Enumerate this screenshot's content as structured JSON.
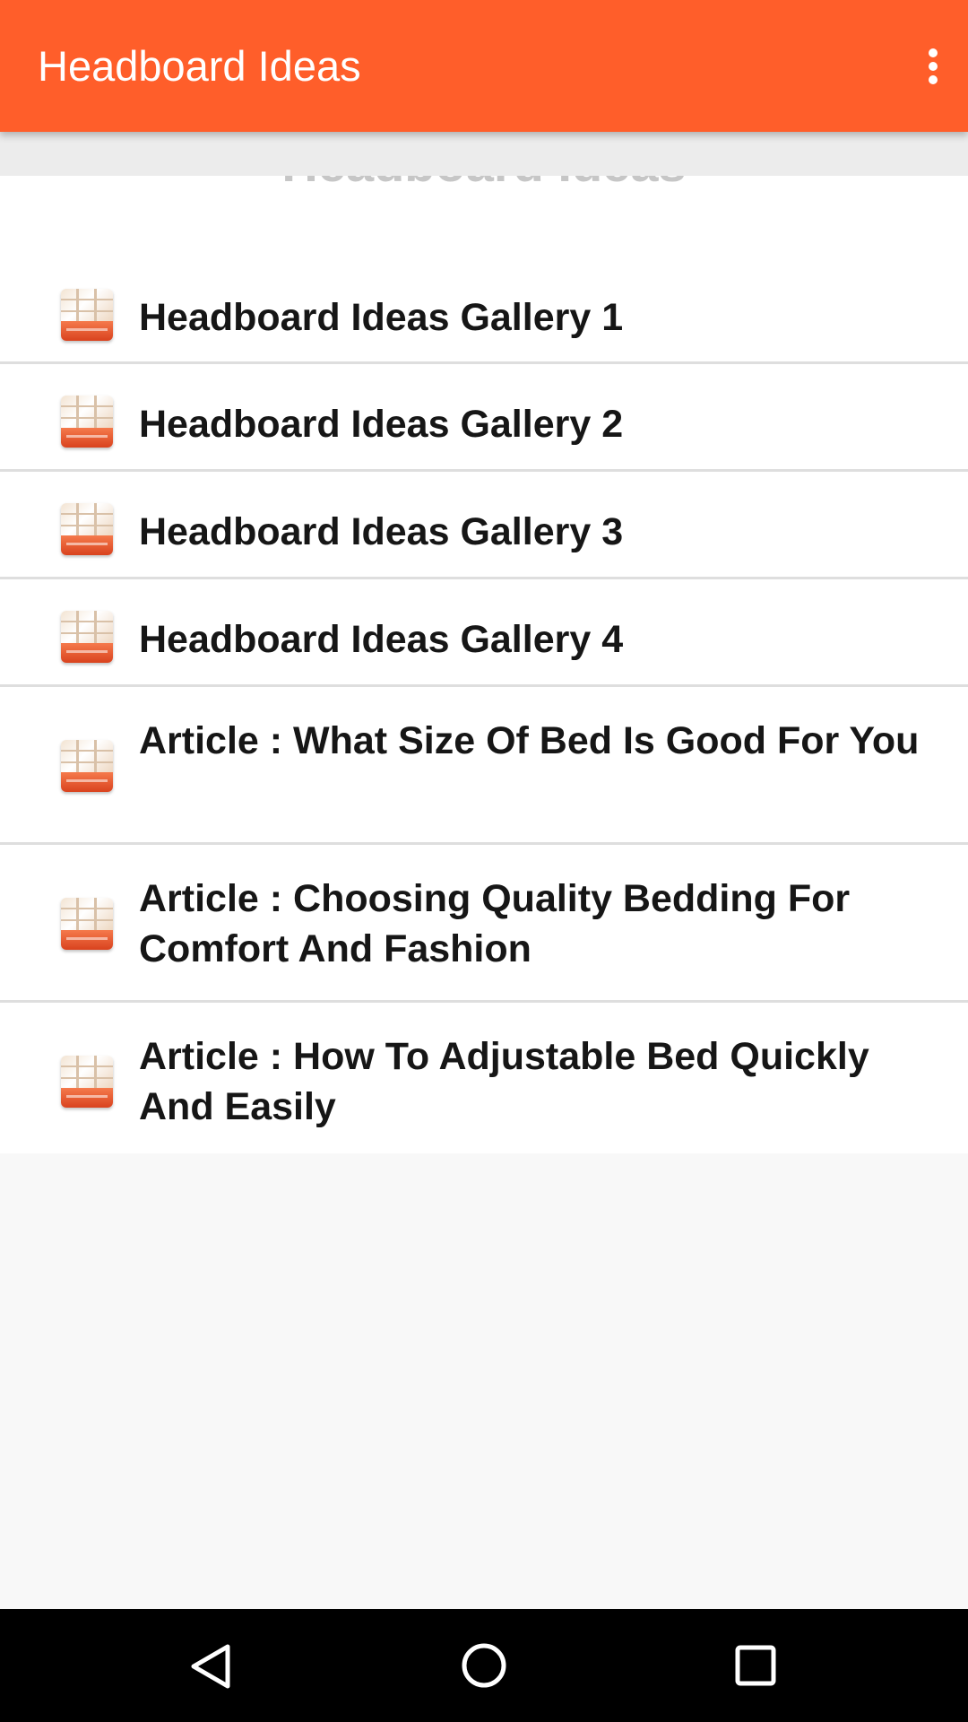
{
  "appbar": {
    "title": "Headboard Ideas",
    "overflow_icon": "more-vert-icon",
    "background": "#ff5e2a"
  },
  "list": {
    "header_text": "Headboard Ideas",
    "items": [
      {
        "label": "Headboard Ideas Gallery 1",
        "icon": "bedroom-thumbnail-icon"
      },
      {
        "label": "Headboard Ideas Gallery 2",
        "icon": "bedroom-thumbnail-icon"
      },
      {
        "label": "Headboard Ideas Gallery 3",
        "icon": "bedroom-thumbnail-icon"
      },
      {
        "label": "Headboard Ideas Gallery 4",
        "icon": "bedroom-thumbnail-icon"
      },
      {
        "label": "Article : What Size Of Bed Is Good For You",
        "icon": "bedroom-thumbnail-icon"
      },
      {
        "label": "Article : Choosing Quality Bedding For Comfort And Fashion",
        "icon": "bedroom-thumbnail-icon"
      },
      {
        "label": "Article : How To Adjustable Bed Quickly And Easily",
        "icon": "bedroom-thumbnail-icon"
      }
    ]
  },
  "navbar": {
    "back_icon": "back-triangle-icon",
    "home_icon": "home-circle-icon",
    "recents_icon": "recents-square-icon"
  }
}
